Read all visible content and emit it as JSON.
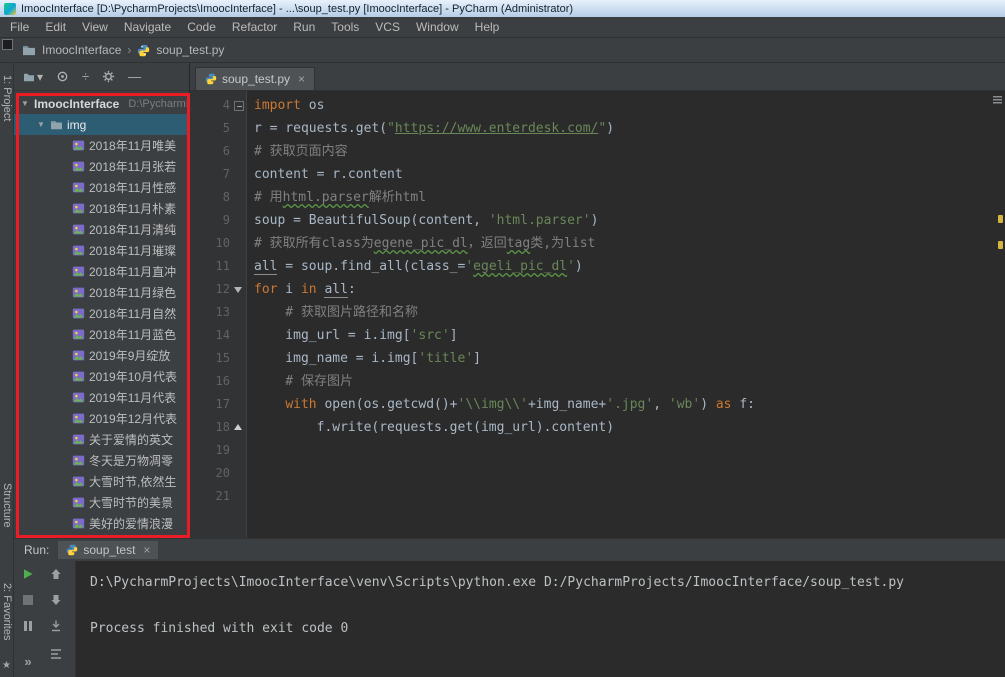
{
  "colors": {
    "keyword": "#cc7832",
    "string": "#6a8759",
    "comment": "#808080",
    "selection": "#2d5d72",
    "annotation": "#ec1c24",
    "play": "#4fae4e"
  },
  "window": {
    "title": "ImoocInterface [D:\\PycharmProjects\\ImoocInterface] - ...\\soup_test.py [ImoocInterface] - PyCharm (Administrator)"
  },
  "menubar": {
    "items": [
      "File",
      "Edit",
      "View",
      "Navigate",
      "Code",
      "Refactor",
      "Run",
      "Tools",
      "VCS",
      "Window",
      "Help"
    ]
  },
  "navbar": {
    "project": "ImoocInterface",
    "file": "soup_test.py"
  },
  "tool_stripes": {
    "project": "1: Project",
    "structure": "Structure",
    "favorites": "2: Favorites"
  },
  "icons": {
    "chevron_expanded": "▼",
    "breadcrumb_separator": "›",
    "close": "×",
    "dropdown": "▾",
    "collapse_all": "÷",
    "hide": "—",
    "more": "»",
    "star": "★"
  },
  "project": {
    "root": "ImoocInterface",
    "root_path": "D:\\PycharmProjects\\ImoocInterface",
    "folder": "img",
    "files": [
      "2018年11月唯美",
      "2018年11月张若",
      "2018年11月性感",
      "2018年11月朴素",
      "2018年11月清纯",
      "2018年11月璀璨",
      "2018年11月直冲",
      "2018年11月绿色",
      "2018年11月自然",
      "2018年11月蓝色",
      "2019年9月绽放",
      "2019年10月代表",
      "2019年11月代表",
      "2019年12月代表",
      "关于爱情的英文",
      "冬天是万物凋零",
      "大雪时节,依然生",
      "大雪时节的美景",
      "美好的爱情浪漫"
    ]
  },
  "editor": {
    "tab": "soup_test.py",
    "lines": [
      {
        "n": "4",
        "fold": "box",
        "seg": [
          [
            "import",
            "kw"
          ],
          [
            " os",
            "pl"
          ]
        ]
      },
      {
        "n": "5",
        "seg": [
          [
            "r = requests.get(",
            "pl"
          ],
          [
            "\"",
            "st"
          ],
          [
            "https://www.enterdesk.com/",
            "st u-link"
          ],
          [
            "\"",
            "st"
          ],
          [
            ")",
            "pl"
          ]
        ]
      },
      {
        "n": "6",
        "seg": [
          [
            "# 获取页面内容",
            "cm"
          ]
        ]
      },
      {
        "n": "7",
        "seg": [
          [
            "content = r.content",
            "pl"
          ]
        ]
      },
      {
        "n": "8",
        "seg": [
          [
            "# 用",
            "cm"
          ],
          [
            "html.parser",
            "cm u-green"
          ],
          [
            "解析html",
            "cm"
          ]
        ]
      },
      {
        "n": "9",
        "seg": [
          [
            "soup = BeautifulSoup(content, ",
            "pl"
          ],
          [
            "'html.parser'",
            "st"
          ],
          [
            ")",
            "pl"
          ]
        ]
      },
      {
        "n": "10",
        "seg": [
          [
            "# 获取所有class为",
            "cm"
          ],
          [
            "egene_pic_dl",
            "cm u-green"
          ],
          [
            "，返回",
            "cm"
          ],
          [
            "tag",
            "cm u-green"
          ],
          [
            "类,为list",
            "cm"
          ]
        ]
      },
      {
        "n": "11",
        "seg": [
          [
            "all",
            "pl u-gray"
          ],
          [
            " = soup.find_all(",
            "pl"
          ],
          [
            "class_=",
            "pl"
          ],
          [
            "'",
            "st"
          ],
          [
            "egeli_pic_dl",
            "st u-green"
          ],
          [
            "'",
            "st"
          ],
          [
            ")",
            "pl"
          ]
        ]
      },
      {
        "n": "12",
        "fold": "down",
        "seg": [
          [
            "for",
            "kw"
          ],
          [
            " i ",
            "pl"
          ],
          [
            "in",
            "kw"
          ],
          [
            " ",
            "pl"
          ],
          [
            "all",
            "pl u-gray"
          ],
          [
            ":",
            "pl"
          ]
        ]
      },
      {
        "n": "13",
        "seg": [
          [
            "    # 获取图片路径和名称",
            "cm"
          ]
        ]
      },
      {
        "n": "14",
        "seg": [
          [
            "    img_url = i.img[",
            "pl"
          ],
          [
            "'src'",
            "st"
          ],
          [
            "]",
            "pl"
          ]
        ]
      },
      {
        "n": "15",
        "seg": [
          [
            "    img_name = i.img[",
            "pl"
          ],
          [
            "'title'",
            "st"
          ],
          [
            "]",
            "pl"
          ]
        ]
      },
      {
        "n": "16",
        "seg": [
          [
            "    # 保存图片",
            "cm"
          ]
        ]
      },
      {
        "n": "17",
        "seg": [
          [
            "    ",
            "pl"
          ],
          [
            "with",
            "kw"
          ],
          [
            " open(os.getcwd()+",
            "pl"
          ],
          [
            "'\\\\img\\\\'",
            "st"
          ],
          [
            "+img_name+",
            "pl"
          ],
          [
            "'.jpg'",
            "st"
          ],
          [
            ", ",
            "pl"
          ],
          [
            "'wb'",
            "st"
          ],
          [
            ") ",
            "pl"
          ],
          [
            "as",
            "kw"
          ],
          [
            " f:",
            "pl"
          ]
        ]
      },
      {
        "n": "18",
        "fold": "up",
        "seg": [
          [
            "        f.write(requests.get(img_url).content)",
            "pl"
          ]
        ]
      },
      {
        "n": "19",
        "seg": []
      },
      {
        "n": "20",
        "seg": []
      },
      {
        "n": "21",
        "seg": []
      }
    ]
  },
  "run": {
    "label": "Run:",
    "tab": "soup_test",
    "console": [
      "D:\\PycharmProjects\\ImoocInterface\\venv\\Scripts\\python.exe D:/PycharmProjects/ImoocInterface/soup_test.py",
      "",
      "Process finished with exit code 0"
    ]
  }
}
